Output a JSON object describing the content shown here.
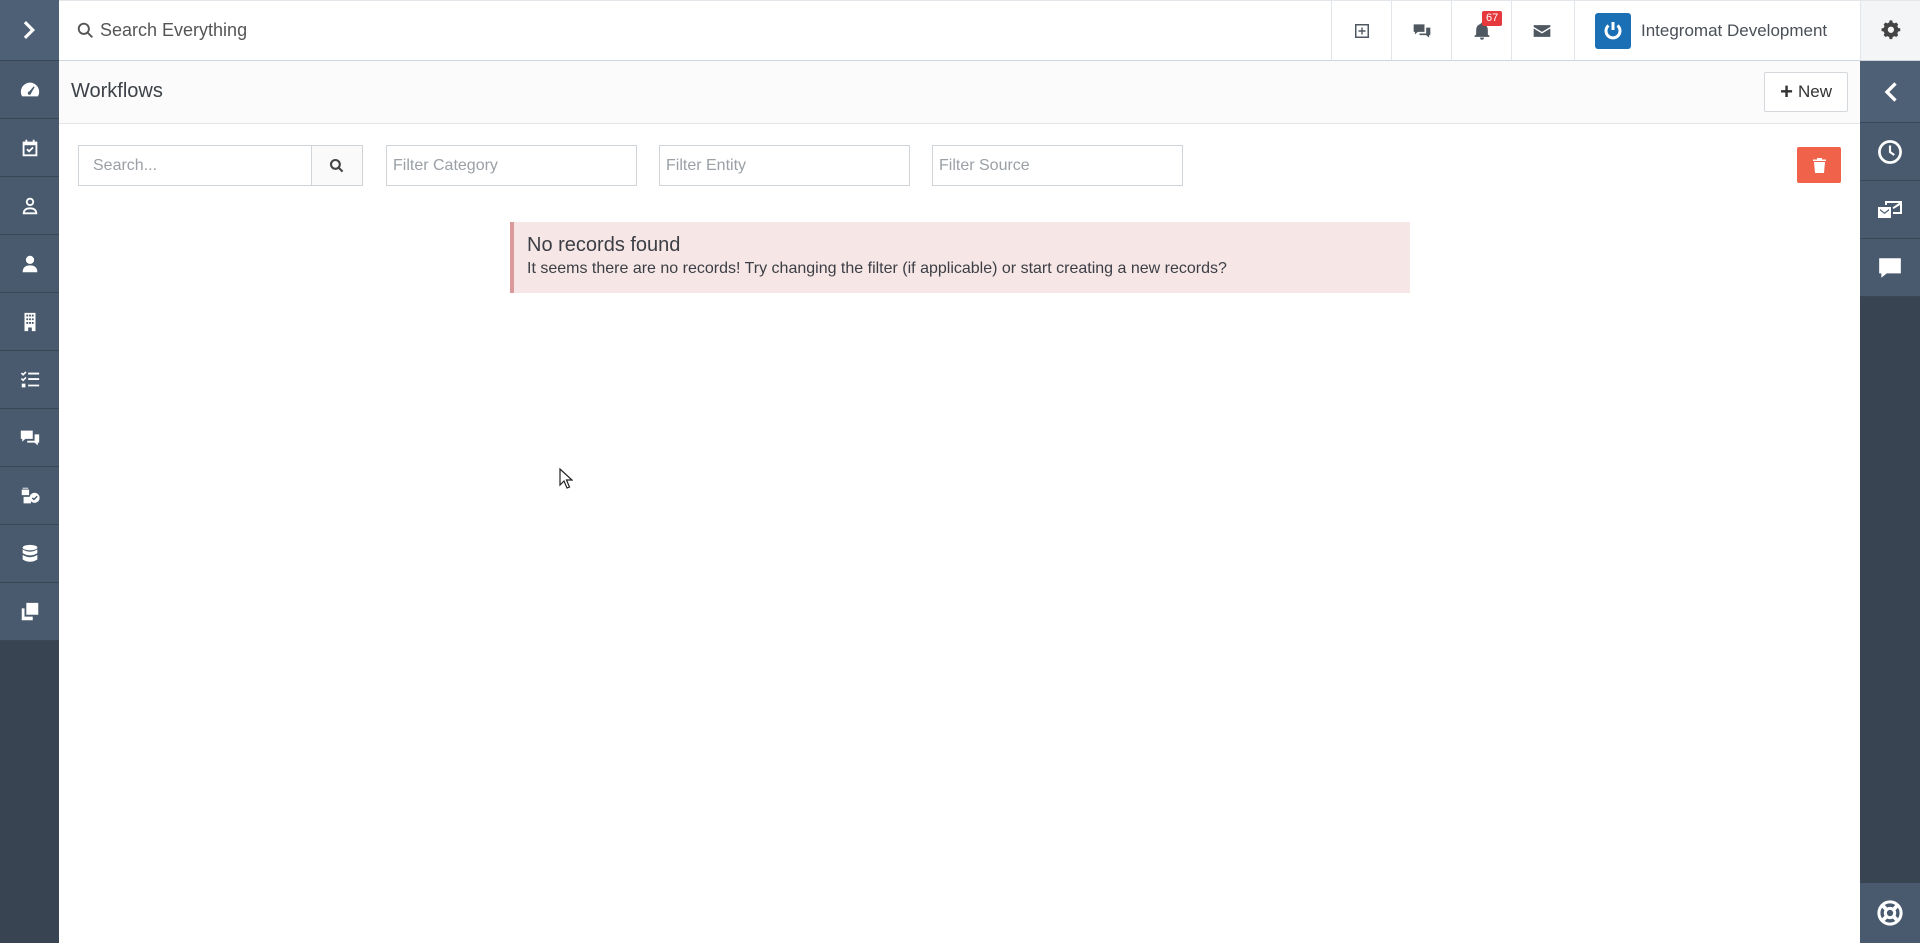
{
  "topbar": {
    "search_placeholder": "Search Everything",
    "notification_count": "67",
    "account_name": "Integromat Development",
    "icons": [
      "plus-square-icon",
      "comments-icon",
      "bell-icon",
      "envelope-icon",
      "gear-icon"
    ]
  },
  "left_sidebar": {
    "items": [
      "chevron-right-icon",
      "dashboard-icon",
      "calendar-check-icon",
      "user-outline-icon",
      "user-icon",
      "building-icon",
      "tasks-icon",
      "comments-icon",
      "cubes-check-icon",
      "database-icon",
      "copy-icon"
    ]
  },
  "header": {
    "title": "Workflows",
    "new_label": "New"
  },
  "filters": {
    "search_placeholder": "Search...",
    "category_placeholder": "Filter Category",
    "entity_placeholder": "Filter Entity",
    "source_placeholder": "Filter Source"
  },
  "alert": {
    "title": "No records found",
    "message": "It seems there are no records! Try changing the filter (if applicable) or start creating a new records?"
  },
  "right_sidebar": {
    "items": [
      "chevron-left-icon",
      "clock-icon",
      "mail-box-icon",
      "comment-icon",
      "life-ring-icon"
    ]
  },
  "colors": {
    "sidebar": "#495a6e",
    "sidebar_dark": "#384452",
    "danger": "#f0634a",
    "alert_bg": "#f6e6e6",
    "badge": "#e5393d",
    "brand": "#1b6fb5"
  }
}
